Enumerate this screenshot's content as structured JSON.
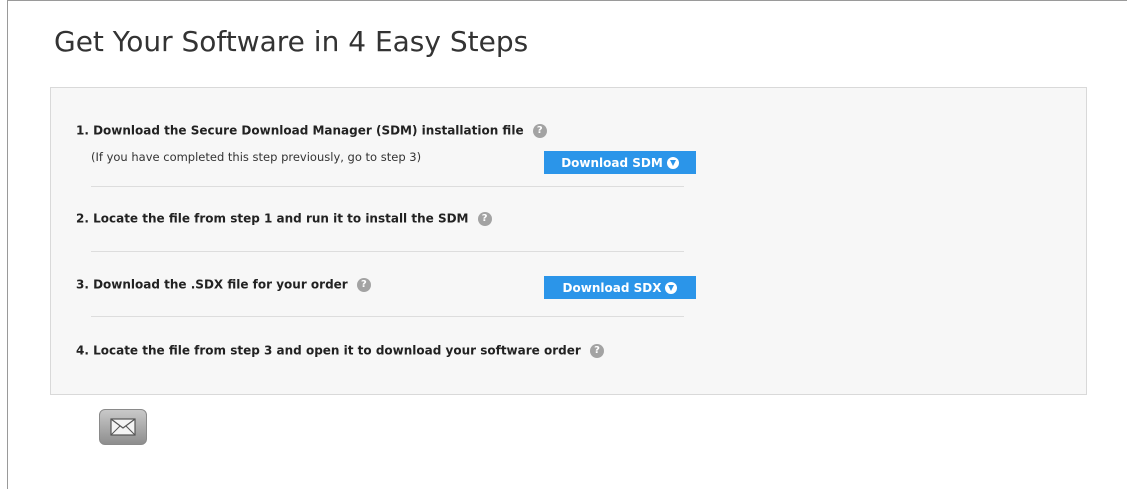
{
  "title": "Get Your Software in 4 Easy Steps",
  "steps": [
    {
      "text": "1. Download the Secure Download Manager (SDM) installation file",
      "note": "(If you have completed this step previously, go to step 3)",
      "button_label": "Download SDM"
    },
    {
      "text": "2. Locate the file from step 1 and run it to install the SDM"
    },
    {
      "text": "3. Download the .SDX file for your order",
      "button_label": "Download SDX"
    },
    {
      "text": "4. Locate the file from step 3 and open it to download your software order"
    }
  ],
  "help_glyph": "?",
  "icons": {
    "help": "question-circle-icon",
    "download": "download-arrow-icon",
    "email": "envelope-icon"
  },
  "colors": {
    "button": "#2b95e9",
    "panel": "#f7f7f7",
    "help_icon": "#a3a3a3"
  }
}
